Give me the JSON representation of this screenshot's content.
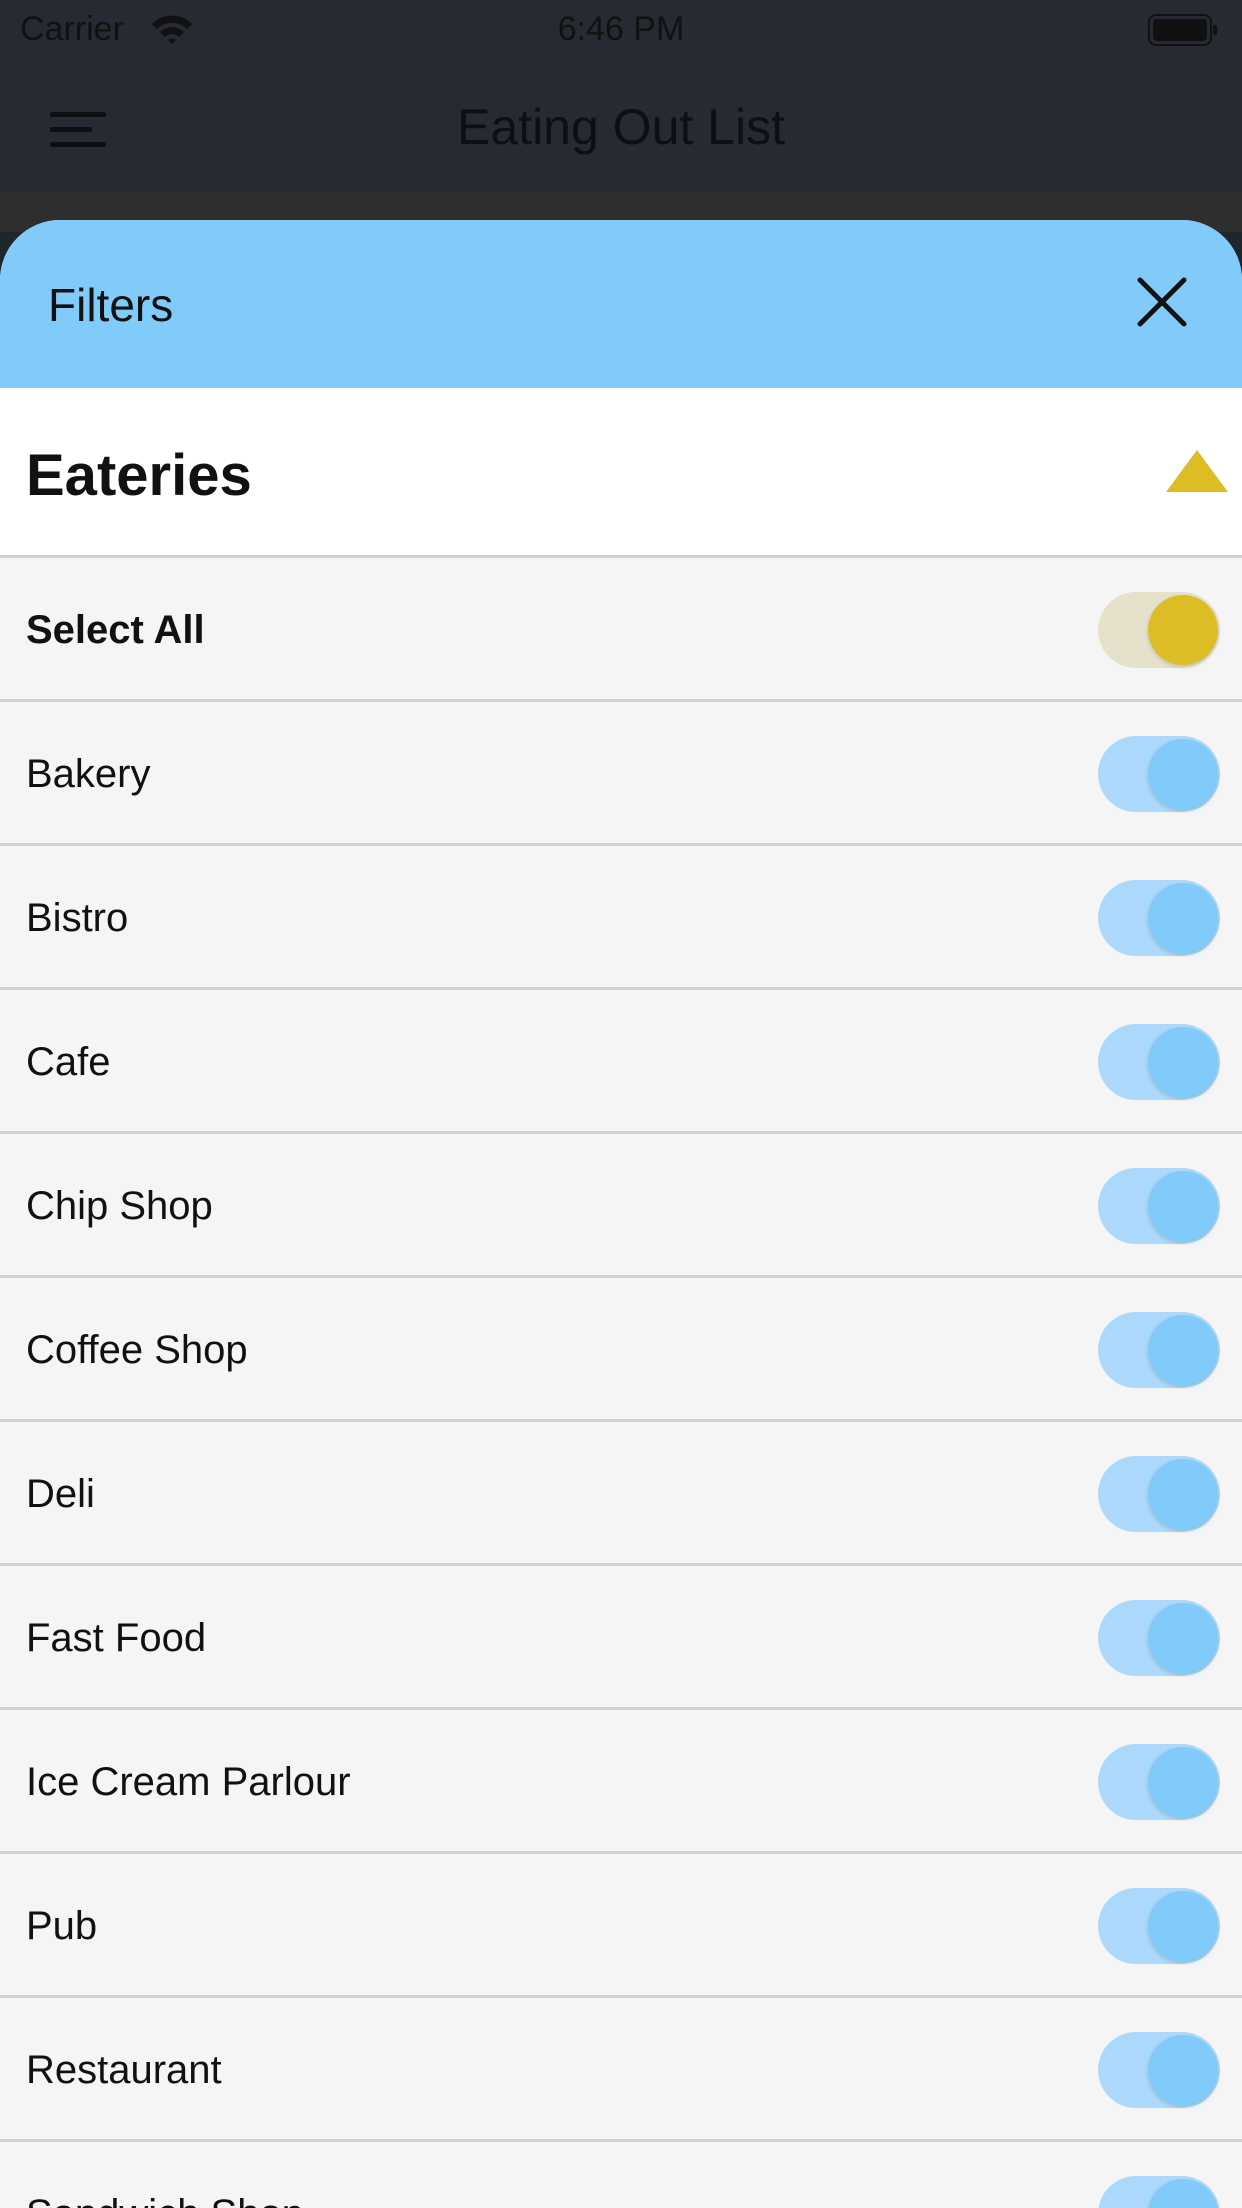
{
  "status_bar": {
    "carrier": "Carrier",
    "time": "6:46 PM"
  },
  "nav": {
    "title": "Eating Out List"
  },
  "sheet": {
    "title": "Filters"
  },
  "section": {
    "title": "Eateries"
  },
  "select_all": {
    "label": "Select All",
    "on": true
  },
  "items": [
    {
      "label": "Bakery",
      "on": true
    },
    {
      "label": "Bistro",
      "on": true
    },
    {
      "label": "Cafe",
      "on": true
    },
    {
      "label": "Chip Shop",
      "on": true
    },
    {
      "label": "Coffee Shop",
      "on": true
    },
    {
      "label": "Deli",
      "on": true
    },
    {
      "label": "Fast Food",
      "on": true
    },
    {
      "label": "Ice Cream Parlour",
      "on": true
    },
    {
      "label": "Pub",
      "on": true
    },
    {
      "label": "Restaurant",
      "on": true
    },
    {
      "label": "Sandwich Shop",
      "on": true
    }
  ],
  "colors": {
    "accent_blue": "#81cbfb",
    "accent_yellow": "#dcbd25",
    "nav_bg": "#262b33"
  }
}
